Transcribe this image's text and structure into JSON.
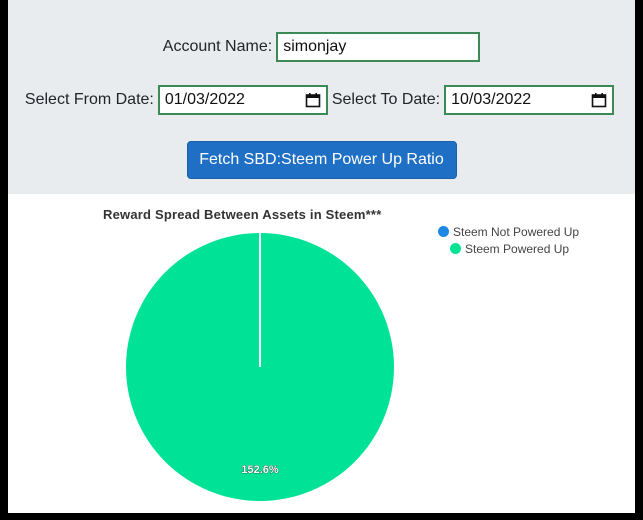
{
  "form": {
    "account_label": "Account Name:",
    "account_value": "simonjay",
    "from_label": "Select From Date:",
    "from_value": "01/03/2022",
    "to_label": "Select To Date:",
    "to_value": "10/03/2022",
    "fetch_label": "Fetch SBD:Steem Power Up Ratio"
  },
  "chart_data": {
    "type": "pie",
    "title": "Reward Spread Between Assets in Steem***",
    "series": [
      {
        "name": "Steem Not Powered Up",
        "value": 0,
        "color": "#1e88e5"
      },
      {
        "name": "Steem Powered Up",
        "value": 152.6,
        "color": "#00e396"
      }
    ],
    "data_label": "152.6%",
    "legend_position": "top-right"
  },
  "colors": {
    "panel": "#e9ecef",
    "button": "#1f6fc5",
    "field_border": "#3c8a55"
  }
}
